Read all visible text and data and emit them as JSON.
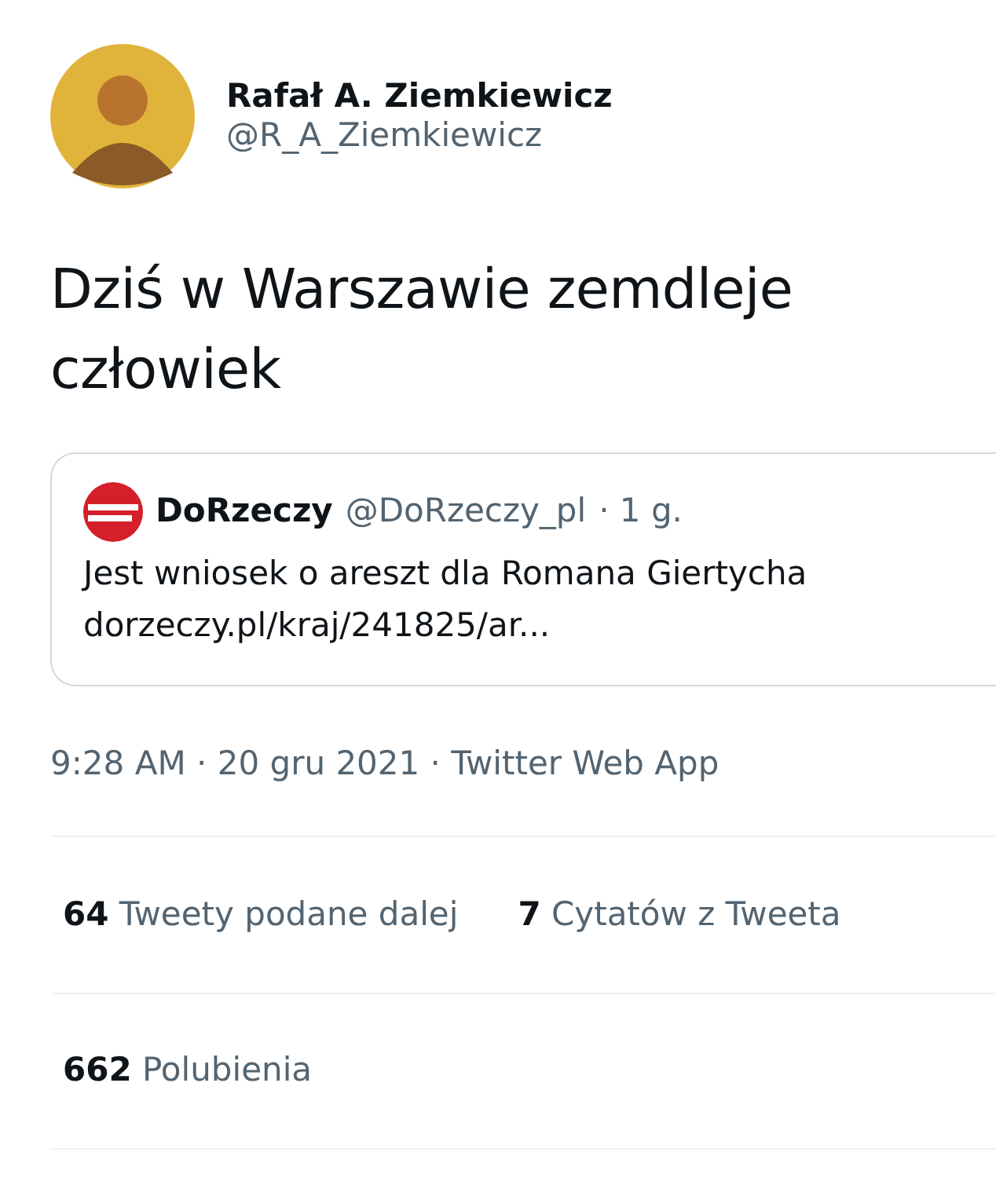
{
  "author": {
    "name": "Rafał A. Ziemkiewicz",
    "handle": "@R_A_Ziemkiewicz"
  },
  "tweet_text": "Dziś w Warszawie zemdleje człowiek",
  "quoted_tweet": {
    "name": "DoRzeczy",
    "handle": "@DoRzeczy_pl",
    "time": "· 1 g.",
    "text": "Jest wniosek o areszt dla Romana Giertycha",
    "link": "dorzeczy.pl/kraj/241825/ar..."
  },
  "meta": "9:28 AM · 20 gru 2021 · Twitter Web App",
  "stats": [
    {
      "items": [
        {
          "count": "64",
          "label": "Tweety podane dalej"
        },
        {
          "count": "7",
          "label": "Cytatów z Tweeta"
        }
      ]
    },
    {
      "items": [
        {
          "count": "662",
          "label": "Polubienia"
        }
      ]
    }
  ]
}
